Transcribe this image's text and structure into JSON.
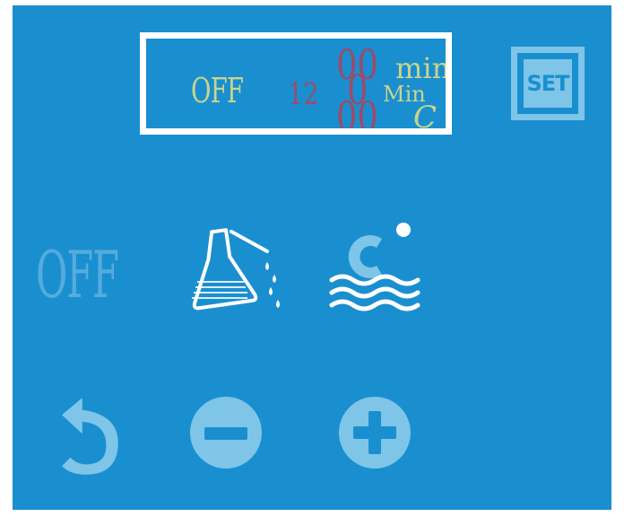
{
  "display": {
    "status": "OFF",
    "time_digits_small": "12",
    "digit_top": "00",
    "digit_mid": "0",
    "digit_bottom": "00",
    "unit_min_top": "min",
    "unit_min_mid": "Min",
    "unit_celsius": "C"
  },
  "buttons": {
    "set_label": "SET",
    "off_label": "OFF"
  },
  "icons": {
    "drain": "flask-pour-icon",
    "heat": "water-temperature-icon",
    "back": "undo-arrow-icon",
    "minus": "minus-circle-icon",
    "plus": "plus-circle-icon"
  },
  "colors": {
    "panel_bg": "#1a8fd0",
    "icon": "#7ec5e8",
    "display_text": "#c9d48a",
    "digit_red": "#9b4b6c"
  }
}
